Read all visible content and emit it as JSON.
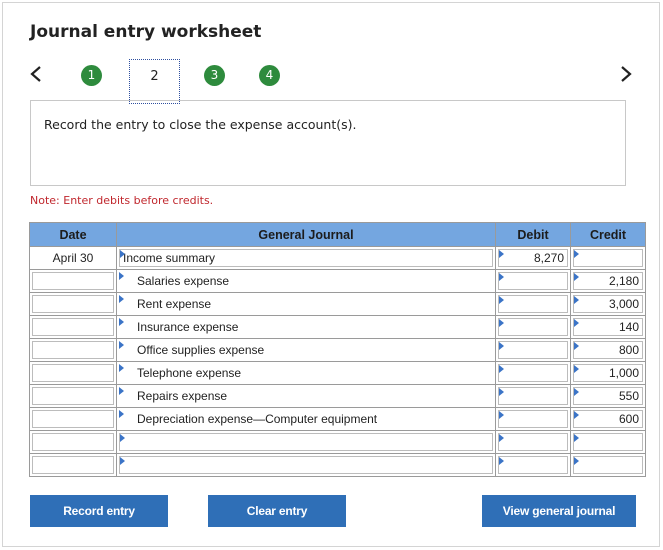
{
  "worksheet": {
    "title": "Journal entry worksheet",
    "steps": [
      "1",
      "2",
      "3",
      "4"
    ],
    "current_step": "2",
    "instruction": "Record the entry to close the expense account(s).",
    "note": "Note: Enter debits before credits."
  },
  "table": {
    "headers": {
      "date": "Date",
      "journal": "General Journal",
      "debit": "Debit",
      "credit": "Credit"
    },
    "rows": [
      {
        "date": "April 30",
        "account": "Income summary",
        "debit": "8,270",
        "credit": ""
      },
      {
        "date": "",
        "account": "Salaries expense",
        "debit": "",
        "credit": "2,180"
      },
      {
        "date": "",
        "account": "Rent expense",
        "debit": "",
        "credit": "3,000"
      },
      {
        "date": "",
        "account": "Insurance expense",
        "debit": "",
        "credit": "140"
      },
      {
        "date": "",
        "account": "Office supplies expense",
        "debit": "",
        "credit": "800"
      },
      {
        "date": "",
        "account": "Telephone expense",
        "debit": "",
        "credit": "1,000"
      },
      {
        "date": "",
        "account": "Repairs expense",
        "debit": "",
        "credit": "550"
      },
      {
        "date": "",
        "account": "Depreciation expense—Computer equipment",
        "debit": "",
        "credit": "600"
      },
      {
        "date": "",
        "account": "",
        "debit": "",
        "credit": ""
      },
      {
        "date": "",
        "account": "",
        "debit": "",
        "credit": ""
      }
    ]
  },
  "buttons": {
    "record": "Record entry",
    "clear": "Clear entry",
    "view": "View general journal"
  },
  "colors": {
    "step_done": "#2e8b3d",
    "header_bg": "#74a6e0",
    "button_bg": "#2f6fb7",
    "note_text": "#c0272d"
  }
}
